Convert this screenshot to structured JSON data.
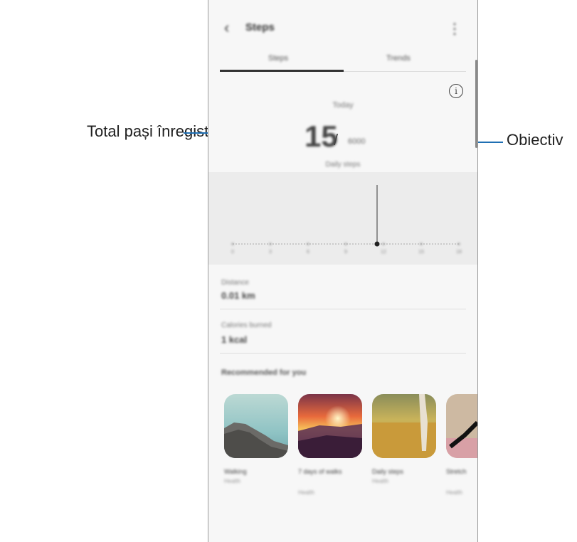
{
  "callouts": {
    "left_label": "Total pași înregistrați",
    "right_label": "Obiectiv"
  },
  "app": {
    "title": "Steps",
    "back_icon": "chevron-left-icon",
    "menu_icon": "more-vert-icon",
    "tabs": [
      {
        "label": "Steps",
        "active": true
      },
      {
        "label": "Trends",
        "active": false
      }
    ]
  },
  "today": {
    "label": "Today",
    "steps": "15",
    "slash": "/",
    "goal": "6000",
    "daily_label": "Daily steps"
  },
  "chart_data": {
    "type": "line",
    "x_ticks": [
      "0",
      "3",
      "6",
      "9",
      "12",
      "15",
      "18"
    ],
    "highlight_index": 3,
    "colors": {
      "bg": "#ececec",
      "line": "#333333",
      "dots": "#9a9a9a"
    }
  },
  "stats": [
    {
      "label": "Distance",
      "value": "0.01 km"
    },
    {
      "label": "Calories burned",
      "value": "1 kcal"
    }
  ],
  "recommended": {
    "title": "Recommended for you",
    "items": [
      {
        "label": "Walking",
        "sub": "Health"
      },
      {
        "label": "7 days of walks",
        "sub": "Health"
      },
      {
        "label": "Daily steps",
        "sub": "Health"
      },
      {
        "label": "Stretch",
        "sub": "Health"
      }
    ]
  }
}
